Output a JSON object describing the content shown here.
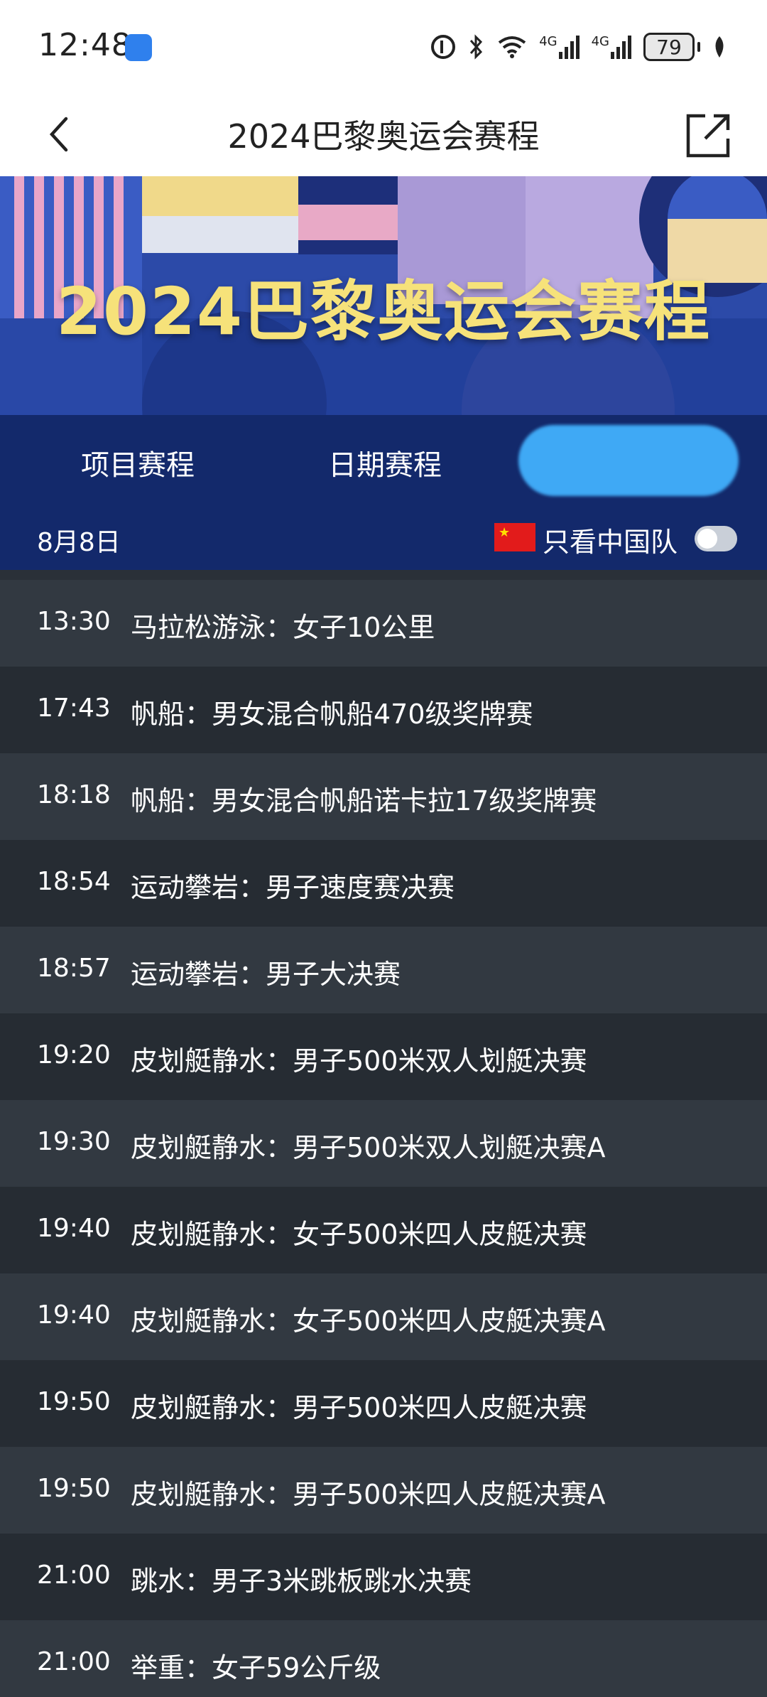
{
  "status_bar": {
    "time": "12:48",
    "network_1": "4G",
    "network_2": "4G",
    "battery": "79"
  },
  "nav": {
    "title": "2024巴黎奥运会赛程"
  },
  "banner": {
    "title": "2024巴黎奥运会赛程"
  },
  "tabs": [
    {
      "label": "项目赛程"
    },
    {
      "label": "日期赛程"
    },
    {
      "label": ""
    }
  ],
  "filter": {
    "date": "8月8日",
    "china_only_label": "只看中国队",
    "china_only_enabled": false
  },
  "schedule": [
    {
      "time": "13:30",
      "event": "马拉松游泳：女子10公里"
    },
    {
      "time": "17:43",
      "event": "帆船：男女混合帆船470级奖牌赛"
    },
    {
      "time": "18:18",
      "event": "帆船：男女混合帆船诺卡拉17级奖牌赛"
    },
    {
      "time": "18:54",
      "event": "运动攀岩：男子速度赛决赛"
    },
    {
      "time": "18:57",
      "event": "运动攀岩：男子大决赛"
    },
    {
      "time": "19:20",
      "event": "皮划艇静水：男子500米双人划艇决赛"
    },
    {
      "time": "19:30",
      "event": "皮划艇静水：男子500米双人划艇决赛A"
    },
    {
      "time": "19:40",
      "event": "皮划艇静水：女子500米四人皮艇决赛"
    },
    {
      "time": "19:40",
      "event": "皮划艇静水：女子500米四人皮艇决赛A"
    },
    {
      "time": "19:50",
      "event": "皮划艇静水：男子500米四人皮艇决赛"
    },
    {
      "time": "19:50",
      "event": "皮划艇静水：男子500米四人皮艇决赛A"
    },
    {
      "time": "21:00",
      "event": "跳水：男子3米跳板跳水决赛"
    },
    {
      "time": "21:00",
      "event": "举重：女子59公斤级"
    }
  ],
  "colors": {
    "nav_bg": "#13296b",
    "active_tab": "#3fa9f5",
    "title_yellow": "#f6e27a"
  }
}
